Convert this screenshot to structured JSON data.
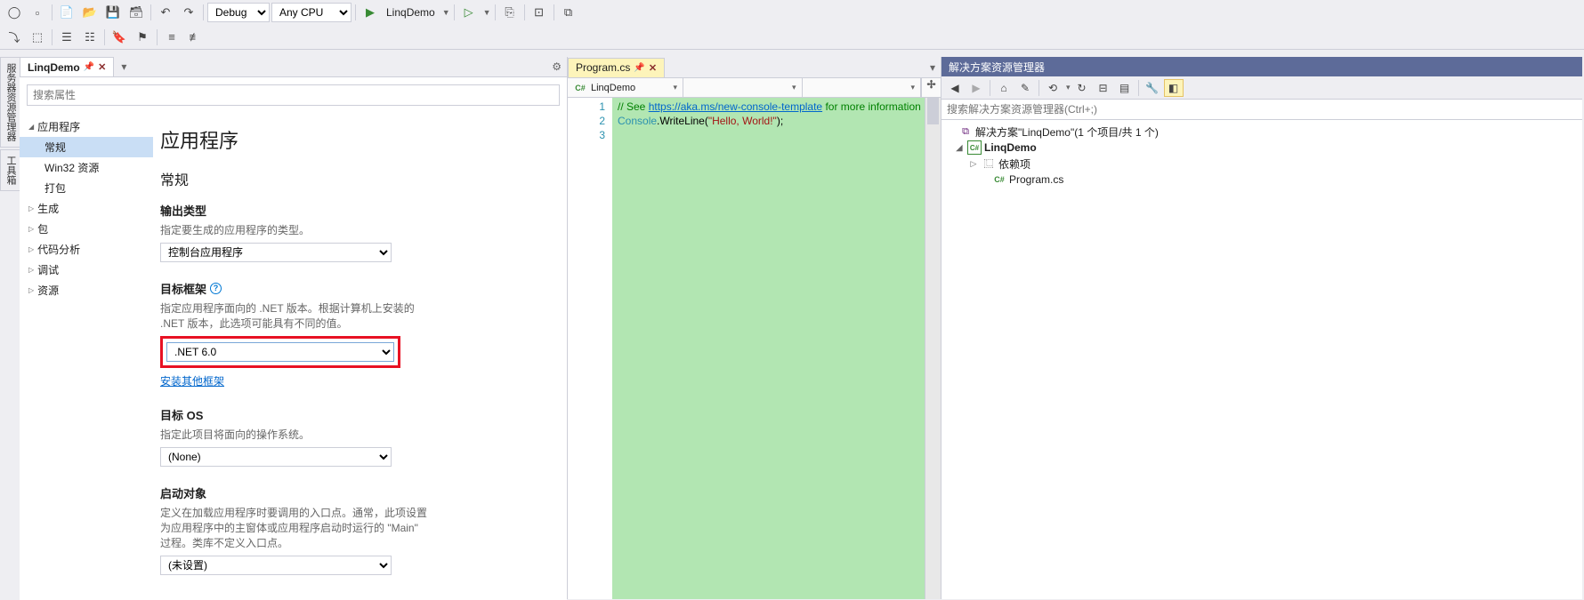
{
  "toolbar": {
    "config_dropdown": "Debug",
    "platform_dropdown": "Any CPU",
    "run_target": "LinqDemo"
  },
  "side_tabs": {
    "t1": "服务器资源管理器",
    "t2": "工具箱"
  },
  "props_tab": {
    "label": "LinqDemo"
  },
  "props_search": {
    "placeholder": "搜索属性"
  },
  "nav": {
    "app": "应用程序",
    "general": "常规",
    "win32": "Win32 资源",
    "package": "打包",
    "build": "生成",
    "pkg": "包",
    "code_analysis": "代码分析",
    "debug": "调试",
    "resources": "资源"
  },
  "content": {
    "title": "应用程序",
    "section": "常规",
    "output_type": {
      "label": "输出类型",
      "desc": "指定要生成的应用程序的类型。",
      "value": "控制台应用程序"
    },
    "target_framework": {
      "label": "目标框架",
      "desc": "指定应用程序面向的 .NET 版本。根据计算机上安装的 .NET 版本，此选项可能具有不同的值。",
      "value": ".NET 6.0",
      "link": "安装其他框架"
    },
    "target_os": {
      "label": "目标 OS",
      "desc": "指定此项目将面向的操作系统。",
      "value": "(None)"
    },
    "startup_object": {
      "label": "启动对象",
      "desc": "定义在加载应用程序时要调用的入口点。通常，此项设置为应用程序中的主窗体或应用程序启动时运行的 \"Main\" 过程。类库不定义入口点。",
      "value": "(未设置)"
    }
  },
  "editor_tab": {
    "label": "Program.cs"
  },
  "editor_bar": {
    "project": "LinqDemo"
  },
  "code": {
    "l1a": "// See ",
    "l1b": "https://aka.ms/new-console-template",
    "l1c": " for more information",
    "l2a": "Console",
    "l2b": ".WriteLine(",
    "l2c": "\"Hello, World!\"",
    "l2d": ");"
  },
  "sol": {
    "title": "解决方案资源管理器",
    "search_placeholder": "搜索解决方案资源管理器(Ctrl+;)",
    "solution": "解决方案\"LinqDemo\"(1 个项目/共 1 个)",
    "project": "LinqDemo",
    "deps": "依赖项",
    "file1": "Program.cs"
  }
}
